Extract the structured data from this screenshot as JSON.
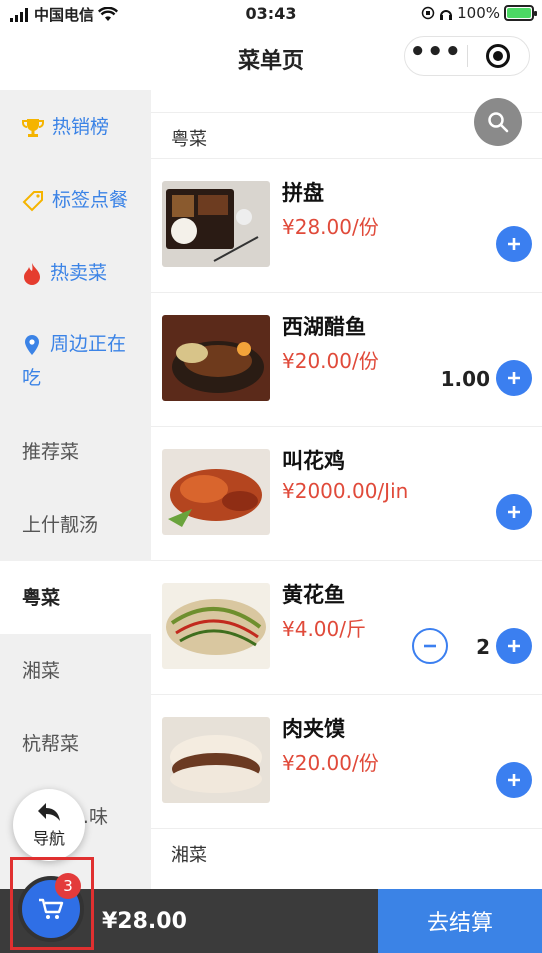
{
  "status_bar": {
    "carrier": "中国电信",
    "time": "03:43",
    "battery": "100%"
  },
  "nav": {
    "title": "菜单页",
    "more_icon": "more-dots-icon",
    "close_icon": "target-circle-icon"
  },
  "sidebar": {
    "items": [
      {
        "label": "热销榜",
        "icon": "trophy-icon",
        "promo": true
      },
      {
        "label": "标签点餐",
        "icon": "tag-icon",
        "promo": true
      },
      {
        "label": "热卖菜",
        "icon": "fire-icon",
        "promo": true
      },
      {
        "label": "周边正在吃",
        "icon": "location-pin-icon",
        "promo": true
      },
      {
        "label": "推荐菜",
        "promo": false
      },
      {
        "label": "上什靓汤",
        "promo": false
      },
      {
        "label": "粤菜",
        "promo": false,
        "active": true
      },
      {
        "label": "湘菜",
        "promo": false
      },
      {
        "label": "杭帮菜",
        "promo": false
      },
      {
        "label": "…味",
        "promo": false
      }
    ]
  },
  "menu": {
    "section_current": "粤菜",
    "section_next": "湘菜",
    "dishes": [
      {
        "name": "拼盘",
        "price": "¥28.00/份",
        "quantity": ""
      },
      {
        "name": "西湖醋鱼",
        "price": "¥20.00/份",
        "quantity": "1.00"
      },
      {
        "name": "叫花鸡",
        "price": "¥2000.00/Jin",
        "quantity": ""
      },
      {
        "name": "黄花鱼",
        "price": "¥4.00/斤",
        "quantity": "2"
      },
      {
        "name": "肉夹馍",
        "price": "¥20.00/份",
        "quantity": ""
      }
    ]
  },
  "nav_fab": {
    "label": "导航"
  },
  "cart": {
    "badge": "3",
    "total": "¥28.00",
    "checkout_label": "去结算"
  },
  "colors": {
    "accent": "#3b7ff0",
    "price": "#e04a3a",
    "bottom_bar": "#3b3b3b",
    "checkout": "#3b83e6",
    "badge": "#e33b3b"
  }
}
